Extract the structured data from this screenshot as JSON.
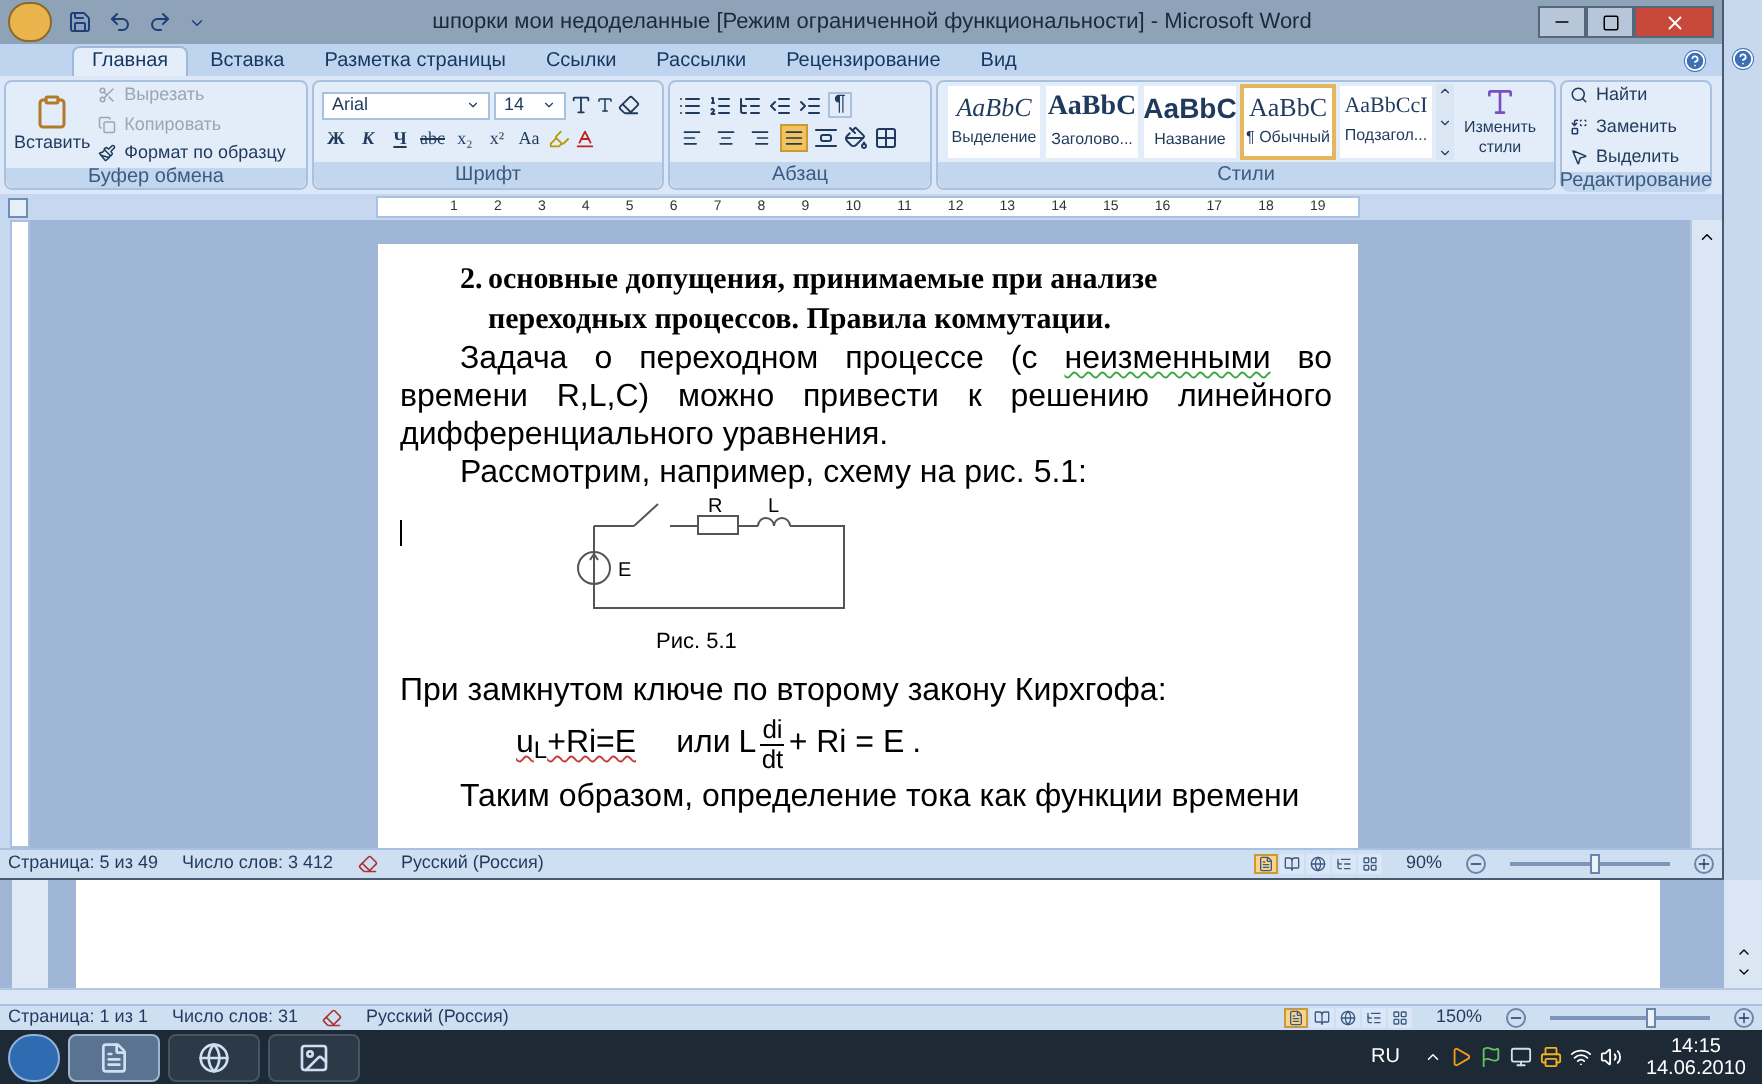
{
  "window": {
    "title": "шпорки мои недоделанные [Режим ограниченной функциональности] - Microsoft Word"
  },
  "tabs": [
    {
      "label": "Главная",
      "selected": true
    },
    {
      "label": "Вставка",
      "selected": false
    },
    {
      "label": "Разметка страницы",
      "selected": false
    },
    {
      "label": "Ссылки",
      "selected": false
    },
    {
      "label": "Рассылки",
      "selected": false
    },
    {
      "label": "Рецензирование",
      "selected": false
    },
    {
      "label": "Вид",
      "selected": false
    }
  ],
  "clipboard": {
    "paste": "Вставить",
    "title": "Буфер обмена",
    "items": [
      {
        "kind": "cut",
        "label": "Вырезать",
        "disabled": true
      },
      {
        "kind": "copy",
        "label": "Копировать",
        "disabled": true
      },
      {
        "kind": "format",
        "label": "Формат по образцу",
        "disabled": false
      }
    ]
  },
  "font": {
    "name": "Arial",
    "size": "14",
    "title": "Шрифт",
    "buttons": [
      {
        "kind": "bold",
        "label": "Ж"
      },
      {
        "kind": "italic",
        "label": "К"
      },
      {
        "kind": "underline",
        "label": "Ч"
      },
      {
        "kind": "strike",
        "label": "abc"
      },
      {
        "kind": "sub",
        "label": "x₂"
      },
      {
        "kind": "sup",
        "label": "x²"
      },
      {
        "kind": "case",
        "label": "Aa"
      }
    ]
  },
  "paragraph": {
    "title": "Абзац",
    "pilcrow": "¶",
    "align": [
      {
        "kind": "left",
        "selected": false
      },
      {
        "kind": "center",
        "selected": false
      },
      {
        "kind": "right",
        "selected": false
      },
      {
        "kind": "justify",
        "selected": true
      }
    ]
  },
  "styles": {
    "title": "Стили",
    "change": "Изменить стили",
    "items": [
      {
        "kind": "emphasis",
        "preview": "AaBbC",
        "label": "Выделение",
        "selected": false
      },
      {
        "kind": "heading",
        "preview": "AaBbC",
        "label": "Заголово...",
        "selected": false
      },
      {
        "kind": "title",
        "preview": "AaBbC",
        "label": "Название",
        "selected": false
      },
      {
        "kind": "normal",
        "preview": "AaBbC",
        "label": "¶ Обычный",
        "selected": true
      },
      {
        "kind": "subtitle",
        "preview": "AaBbCcI",
        "label": "Подзагол...",
        "selected": false
      }
    ]
  },
  "editing": {
    "title": "Редактирование",
    "items": [
      {
        "kind": "find",
        "label": "Найти"
      },
      {
        "kind": "replace",
        "label": "Заменить"
      },
      {
        "kind": "select",
        "label": "Выделить"
      }
    ]
  },
  "ruler": {
    "ticks": [
      "1",
      "2",
      "3",
      "4",
      "5",
      "6",
      "7",
      "8",
      "9",
      "10",
      "11",
      "12",
      "13",
      "14",
      "15",
      "16",
      "17",
      "18",
      "19"
    ]
  },
  "document": {
    "heading": {
      "number": "2.",
      "text": "основные допущения, принимаемые при анализе переходных процессов. Правила коммутации."
    },
    "paragraphs": [
      {
        "segments": [
          {
            "text": "Задача о переходном процессе (с ",
            "flagged": false
          },
          {
            "text": "неизменными",
            "flagged": true
          },
          {
            "text": " во времени R,L,C) можно привести к решению линейного дифференциального уравнения.",
            "flagged": false
          }
        ]
      },
      {
        "segments": [
          {
            "text": "Рассмотрим, например, схему на рис. 5.1:",
            "flagged": false
          }
        ]
      }
    ],
    "figure": {
      "resistor": "R",
      "inductor": "L",
      "source": "E",
      "caption": "Рис. 5.1"
    },
    "after": "При замкнутом ключе по второму закону Кирхгофа:",
    "equation": {
      "lhs": "u$_{L}$+Ri=E",
      "lhs_flagged": true,
      "or": "или",
      "coef": "L",
      "numerator": "di",
      "denominator": "dt",
      "rhs": "+ Ri = E",
      "end": "."
    },
    "last": "Таким образом, определение тока как функции времени"
  },
  "status": {
    "page": "Страница: 5 из 49",
    "words": "Число слов: 3 412",
    "language": "Русский (Россия)",
    "zoom": "90%",
    "level": 0.5,
    "views": [
      {
        "selected": true
      },
      {
        "selected": false
      },
      {
        "selected": false
      },
      {
        "selected": false
      },
      {
        "selected": false
      }
    ]
  },
  "back_status": {
    "page": "Страница: 1 из 1",
    "words": "Число слов: 31",
    "language": "Русский (Россия)",
    "zoom": "150%",
    "level": 0.6,
    "views": [
      {
        "selected": true
      },
      {
        "selected": false
      },
      {
        "selected": false
      },
      {
        "selected": false
      },
      {
        "selected": false
      }
    ]
  },
  "taskbar": {
    "apps": [
      {
        "kind": "word",
        "selected": true
      },
      {
        "kind": "browser",
        "selected": false
      },
      {
        "kind": "viewer",
        "selected": false
      }
    ],
    "language": "RU",
    "time": "14:15",
    "date": "14.06.2010"
  }
}
